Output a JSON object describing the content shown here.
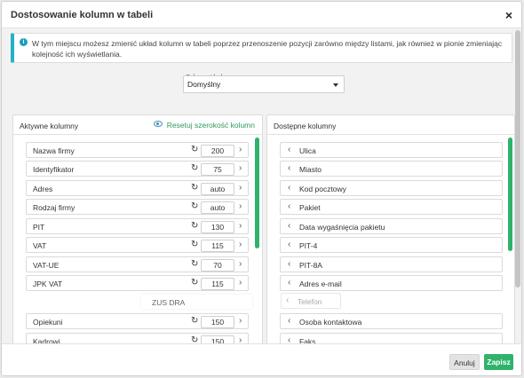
{
  "dialog": {
    "title": "Dostosowanie kolumn w tabeli",
    "close_label": "×"
  },
  "info": {
    "icon": "info-icon",
    "text": "W tym miejscu możesz zmienić układ kolumn w tabeli poprzez przenoszenie pozycji zarówno między listami, jak również w pionie zmieniając kolejność ich wyświetlania."
  },
  "schema": {
    "label": "Schemat kolumn",
    "value": "Domyślny"
  },
  "active_panel": {
    "title": "Aktywne kolumny",
    "reset_label": "Resetuj szerokość kolumn",
    "items": [
      {
        "label": "Nazwa firmy",
        "width": "200"
      },
      {
        "label": "Identyfikator",
        "width": "75"
      },
      {
        "label": "Adres",
        "width": "auto"
      },
      {
        "label": "Rodzaj firmy",
        "width": "auto"
      },
      {
        "label": "PIT",
        "width": "130"
      },
      {
        "label": "VAT",
        "width": "115"
      },
      {
        "label": "VAT-UE",
        "width": "70"
      },
      {
        "label": "JPK VAT",
        "width": "115"
      },
      {
        "label": "Opiekuni",
        "width": "150"
      },
      {
        "label": "Kadrowi",
        "width": "150"
      }
    ],
    "dragging": {
      "label": "ZUS DRA"
    }
  },
  "available_panel": {
    "title": "Dostępne kolumny",
    "items": [
      {
        "label": "Ulica"
      },
      {
        "label": "Miasto"
      },
      {
        "label": "Kod pocztowy"
      },
      {
        "label": "Pakiet"
      },
      {
        "label": "Data wygaśnięcia pakietu"
      },
      {
        "label": "PIT-4"
      },
      {
        "label": "PIT-8A"
      },
      {
        "label": "Adres e-mail"
      },
      {
        "label": "Osoba kontaktowa"
      },
      {
        "label": "Faks"
      }
    ],
    "dragging": {
      "label": "Telefon"
    }
  },
  "footer": {
    "cancel_label": "Anuluj",
    "save_label": "Zapisz"
  },
  "colors": {
    "accent": "#2fb36b",
    "info_border": "#22b2c8",
    "link": "#2f9a5b"
  }
}
